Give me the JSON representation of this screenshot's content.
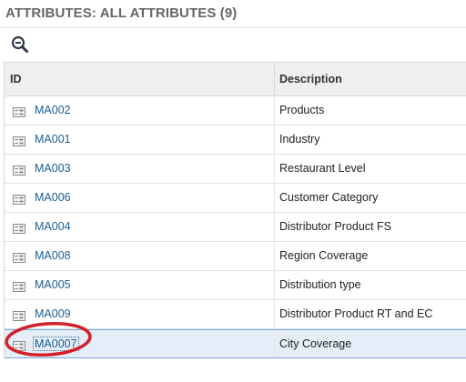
{
  "header": {
    "title": "ATTRIBUTES: ALL ATTRIBUTES (9)"
  },
  "toolbar": {
    "zoom_icon": "zoom-out-magnifier-icon"
  },
  "table": {
    "columns": {
      "id": "ID",
      "description": "Description"
    },
    "rows": [
      {
        "id": "MA002",
        "description": "Products"
      },
      {
        "id": "MA001",
        "description": "Industry"
      },
      {
        "id": "MA003",
        "description": "Restaurant Level"
      },
      {
        "id": "MA006",
        "description": "Customer Category"
      },
      {
        "id": "MA004",
        "description": "Distributor Product FS"
      },
      {
        "id": "MA008",
        "description": "Region Coverage"
      },
      {
        "id": "MA005",
        "description": "Distribution type"
      },
      {
        "id": "MA009",
        "description": "Distributor Product RT and EC"
      },
      {
        "id": "MA0007",
        "description": "City Coverage",
        "selected": true
      }
    ],
    "row_icon": "detail-record-icon"
  },
  "colors": {
    "link": "#1d5f93",
    "header_bg": "#efefef",
    "selected_bg": "#e5eef8",
    "annotation_circle": "#d4202a"
  }
}
